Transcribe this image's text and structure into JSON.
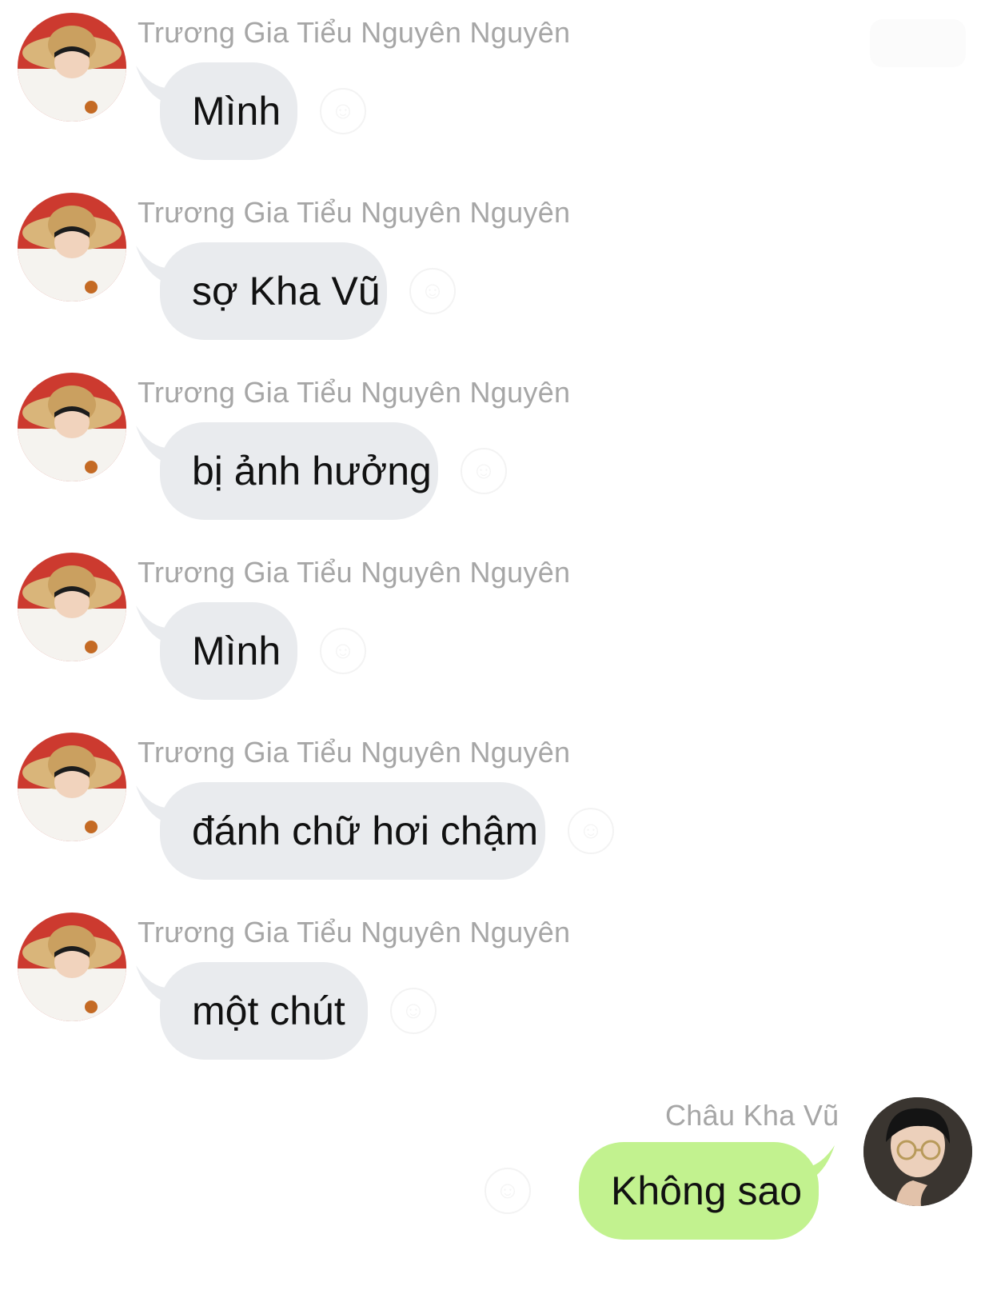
{
  "chat": {
    "messages": [
      {
        "sender": "Trương Gia Tiểu Nguyên Nguyên",
        "text": "Mình"
      },
      {
        "sender": "Trương Gia Tiểu Nguyên Nguyên",
        "text": "sợ Kha Vũ"
      },
      {
        "sender": "Trương Gia Tiểu Nguyên Nguyên",
        "text": "bị ảnh hưởng"
      },
      {
        "sender": "Trương Gia Tiểu Nguyên Nguyên",
        "text": "Mình"
      },
      {
        "sender": "Trương Gia Tiểu Nguyên Nguyên",
        "text": "đánh chữ hơi chậm"
      },
      {
        "sender": "Trương Gia Tiểu Nguyên Nguyên",
        "text": "một chút"
      }
    ],
    "reply": {
      "sender": "Châu Kha Vũ",
      "text": "Không sao"
    }
  },
  "colors": {
    "incoming_bubble": "#e9ebee",
    "outgoing_bubble": "#c2f28f",
    "sender_name": "#a6a6a6"
  },
  "icons": {
    "reaction": "smiley-icon",
    "incoming_avatar": "avatar-straw-hat",
    "outgoing_avatar": "avatar-glasses"
  }
}
